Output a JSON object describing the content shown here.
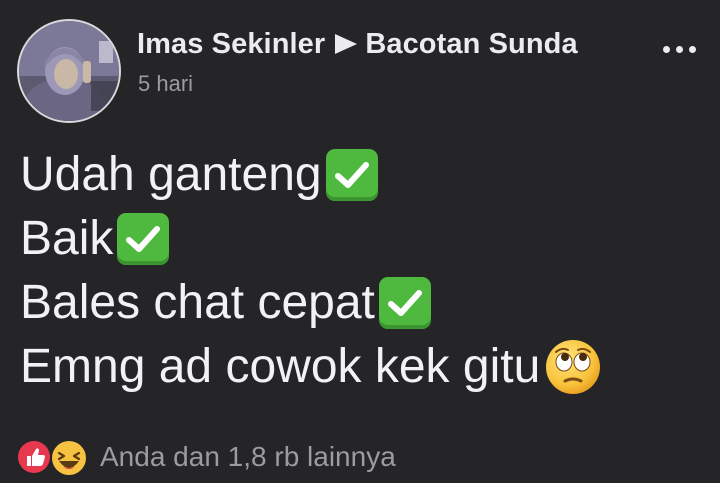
{
  "post": {
    "author": "Imas Sekinler",
    "group": "Bacotan Sunda",
    "time": "5 hari",
    "lines": [
      "Udah ganteng",
      "Baik",
      "Bales chat cepat",
      "Emng ad cowok kek gitu"
    ],
    "line_emojis": [
      "check-mark-button",
      "check-mark-button",
      "check-mark-button",
      "face-with-rolling-eyes"
    ],
    "reaction_summary": "Anda dan 1,8 rb lainnya",
    "reaction_types": [
      "like",
      "haha"
    ]
  },
  "colors": {
    "background": "#252527",
    "text": "#f2f2f4",
    "muted": "#9b9ba0",
    "check_green": "#4eb83f",
    "like_red": "#e8384f",
    "haha_yellow": "#f7c241"
  }
}
